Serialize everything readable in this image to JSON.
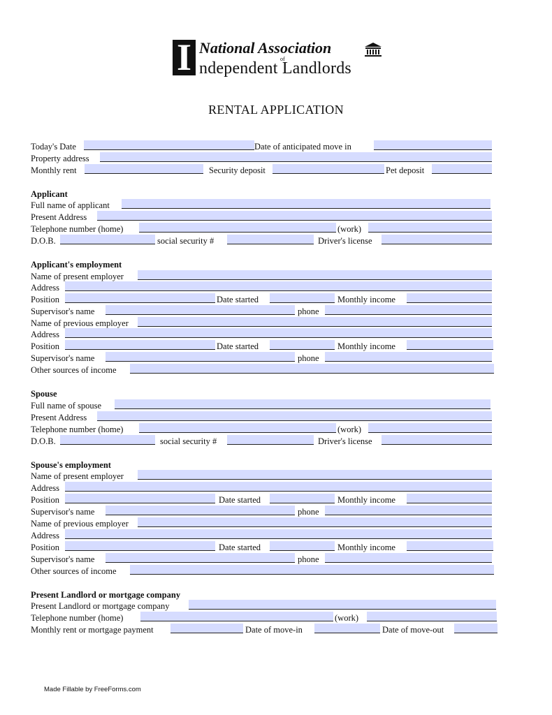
{
  "logo": {
    "initial": "I",
    "line1": "National Association",
    "of": "of",
    "line2": "ndependent Landlords",
    "icon": "bank-building-icon"
  },
  "title": "RENTAL APPLICATION",
  "general": {
    "todays_date": "Today's Date",
    "move_in": "Date of anticipated move in",
    "property_address": "Property address",
    "monthly_rent": "Monthly rent",
    "security_deposit": "Security deposit",
    "pet_deposit": "Pet deposit"
  },
  "applicant": {
    "heading": "Applicant",
    "full_name": "Full name of applicant",
    "present_address": "Present Address",
    "telephone_home": "Telephone number (home)",
    "work": "(work)",
    "dob": "D.O.B.",
    "ssn": "social security #",
    "drivers_license": "Driver's license"
  },
  "applicant_employment": {
    "heading": "Applicant's employment",
    "present_employer": "Name of present employer",
    "address": "Address",
    "position": "Position",
    "date_started": "Date started",
    "monthly_income": "Monthly income",
    "supervisor": "Supervisor's name",
    "phone": "phone",
    "previous_employer": "Name of previous employer",
    "address2": "Address",
    "position2": "Position",
    "date_started2": "Date started",
    "monthly_income2": "Monthly income",
    "supervisor2": "Supervisor's name",
    "phone2": "phone",
    "other_income": "Other sources of income"
  },
  "spouse": {
    "heading": "Spouse",
    "full_name": "Full name of spouse",
    "present_address": "Present Address",
    "telephone_home": "Telephone number (home)",
    "work": "(work)",
    "dob": "D.O.B.",
    "ssn": "social security #",
    "drivers_license": "Driver's license"
  },
  "spouse_employment": {
    "heading": "Spouse's employment",
    "present_employer": "Name of present employer",
    "address": "Address",
    "position": "Position",
    "date_started": "Date started",
    "monthly_income": "Monthly income",
    "supervisor": "Supervisor's name",
    "phone": "phone",
    "previous_employer": "Name of previous employer",
    "address2": "Address",
    "position2": "Position",
    "date_started2": "Date started",
    "monthly_income2": "Monthly income",
    "supervisor2": "Supervisor's name",
    "phone2": "phone",
    "other_income": "Other sources of income"
  },
  "landlord": {
    "heading": "Present Landlord or mortgage company",
    "company": "Present Landlord or mortgage company",
    "telephone_home": "Telephone number (home)",
    "work": "(work)",
    "monthly_payment": "Monthly rent or mortgage payment",
    "move_in": "Date of move-in",
    "move_out": "Date of move-out"
  },
  "fields": {
    "value": "",
    "fill_color": "#d6dcff"
  },
  "footer": "Made Fillable by FreeForms.com"
}
